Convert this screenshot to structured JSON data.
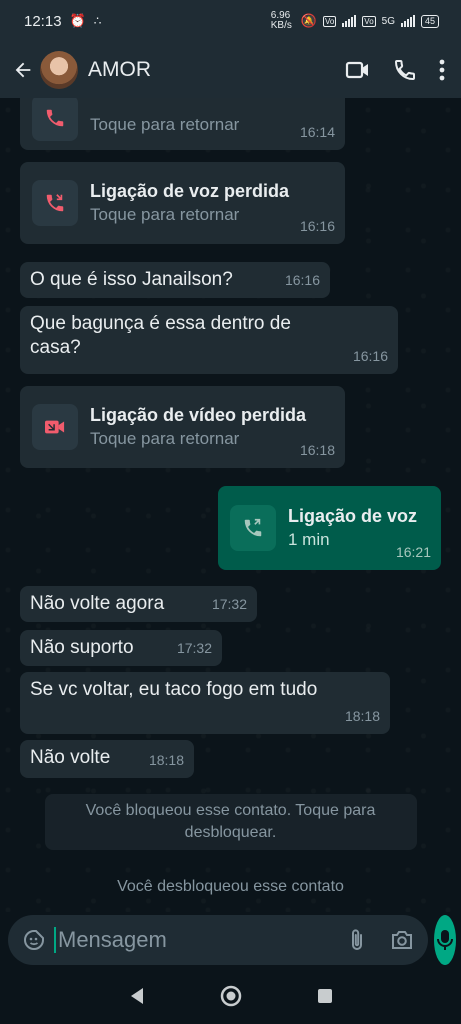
{
  "status": {
    "time": "12:13",
    "net_speed": "6.96 KB/s",
    "net": "5G",
    "battery": "45"
  },
  "header": {
    "contact_name": "AMOR"
  },
  "messages": {
    "m0": {
      "subtitle": "Toque para retornar",
      "time": "16:14"
    },
    "m1": {
      "title": "Ligação de voz perdida",
      "subtitle": "Toque para retornar",
      "time": "16:16"
    },
    "m2": {
      "text": "O que é isso Janailson?",
      "time": "16:16"
    },
    "m3": {
      "text": "Que bagunça é essa dentro de casa?",
      "time": "16:16"
    },
    "m4": {
      "title": "Ligação de vídeo perdida",
      "subtitle": "Toque para retornar",
      "time": "16:18"
    },
    "m5": {
      "title": "Ligação de voz",
      "subtitle": "1 min",
      "time": "16:21"
    },
    "m6": {
      "text": "Não volte agora",
      "time": "17:32"
    },
    "m7": {
      "text": "Não suporto",
      "time": "17:32"
    },
    "m8": {
      "text": "Se vc voltar, eu taco fogo em tudo",
      "time": "18:18"
    },
    "m9": {
      "text": "Não volte",
      "time": "18:18"
    }
  },
  "system": {
    "blocked": "Você bloqueou esse contato. Toque para desbloquear.",
    "unblocked": "Você desbloqueou esse contato"
  },
  "input": {
    "placeholder": "Mensagem"
  },
  "colors": {
    "accent": "#00a884",
    "missed": "#f15c6d",
    "outgoing": "#005c4b",
    "incoming": "#202c33"
  }
}
